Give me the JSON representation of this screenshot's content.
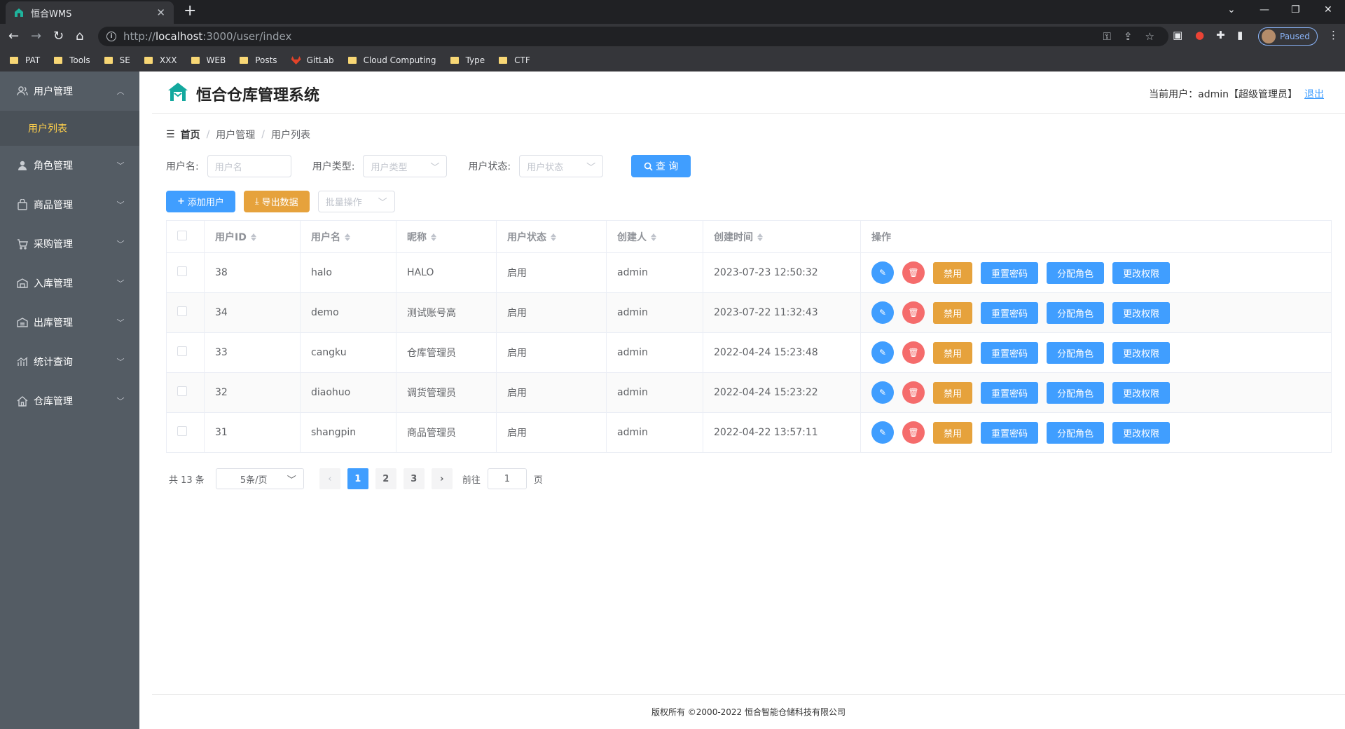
{
  "browser": {
    "tab_title": "恒合WMS",
    "url_prefix": "http://",
    "url_host": "localhost",
    "url_rest": ":3000/user/index",
    "profile_label": "Paused",
    "bookmarks": [
      "PAT",
      "Tools",
      "SE",
      "XXX",
      "WEB",
      "Posts",
      "GitLab",
      "Cloud Computing",
      "Type",
      "CTF"
    ]
  },
  "header": {
    "brand": "恒合仓库管理系统",
    "current_user": "当前用户：admin【超级管理员】",
    "logout": "退出"
  },
  "sidebar": {
    "items": [
      {
        "label": "用户管理",
        "icon": "user-group-icon",
        "expanded": true
      },
      {
        "label": "角色管理",
        "icon": "person-icon"
      },
      {
        "label": "商品管理",
        "icon": "bag-icon"
      },
      {
        "label": "采购管理",
        "icon": "cart-icon"
      },
      {
        "label": "入库管理",
        "icon": "warehouse-in-icon"
      },
      {
        "label": "出库管理",
        "icon": "warehouse-out-icon"
      },
      {
        "label": "统计查询",
        "icon": "chart-icon"
      },
      {
        "label": "仓库管理",
        "icon": "home-icon"
      }
    ],
    "subitem_active": "用户列表"
  },
  "breadcrumb": [
    "首页",
    "用户管理",
    "用户列表"
  ],
  "search": {
    "username_label": "用户名:",
    "username_placeholder": "用户名",
    "type_label": "用户类型:",
    "type_placeholder": "用户类型",
    "status_label": "用户状态:",
    "status_placeholder": "用户状态",
    "query_button": "查 询"
  },
  "actions": {
    "add": "添加用户",
    "export": "导出数据",
    "batch": "批量操作"
  },
  "table": {
    "columns": [
      "用户ID",
      "用户名",
      "昵称",
      "用户状态",
      "创建人",
      "创建时间",
      "操作"
    ],
    "rows": [
      [
        "38",
        "halo",
        "HALO",
        "启用",
        "admin",
        "2023-07-23 12:50:32"
      ],
      [
        "34",
        "demo",
        "测试账号高",
        "启用",
        "admin",
        "2023-07-22 11:32:43"
      ],
      [
        "33",
        "cangku",
        "仓库管理员",
        "启用",
        "admin",
        "2022-04-24 15:23:48"
      ],
      [
        "32",
        "diaohuo",
        "调货管理员",
        "启用",
        "admin",
        "2022-04-24 15:23:22"
      ],
      [
        "31",
        "shangpin",
        "商品管理员",
        "启用",
        "admin",
        "2022-04-22 13:57:11"
      ]
    ],
    "op_labels": {
      "disable": "禁用",
      "reset": "重置密码",
      "role": "分配角色",
      "perm": "更改权限"
    }
  },
  "pager": {
    "total": "共 13 条",
    "size": "5条/页",
    "pages": [
      "1",
      "2",
      "3"
    ],
    "current": "1",
    "goto_label": "前往",
    "goto_value": "1",
    "page_suffix": "页"
  },
  "footer": "版权所有 ©2000-2022  恒合智能仓储科技有限公司",
  "colors": {
    "primary": "#409eff",
    "warning": "#e6a23c",
    "danger": "#f56c6c",
    "sidebar": "#545c64",
    "active_sub": "#ffd04b"
  }
}
